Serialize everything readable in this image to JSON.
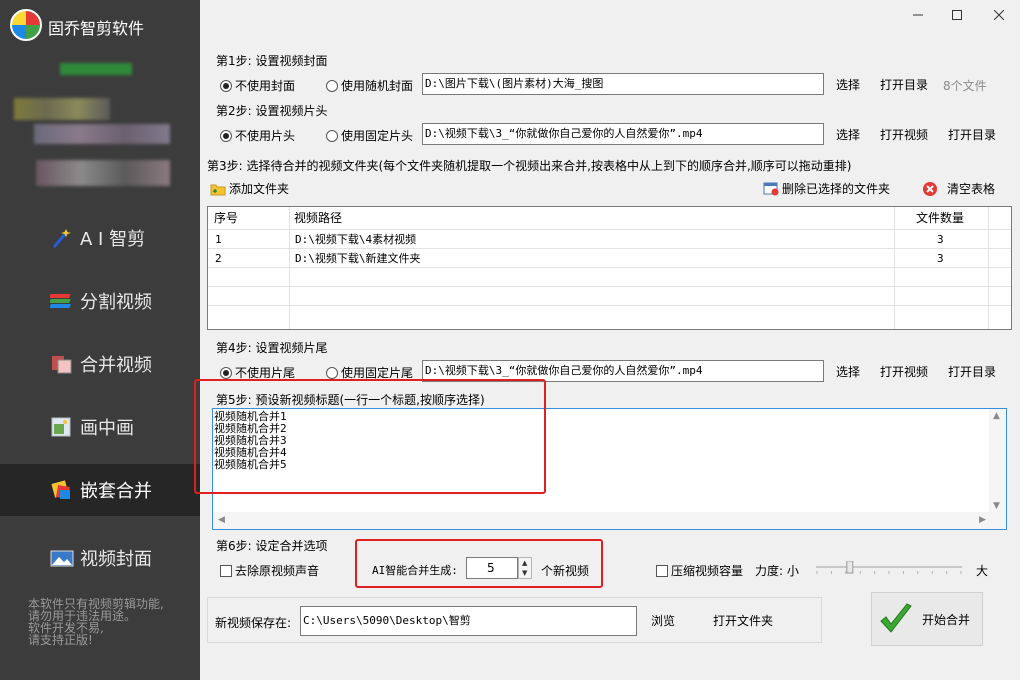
{
  "app": {
    "title": "固乔智剪软件"
  },
  "sidebar": {
    "items": [
      {
        "label": "A I 智剪",
        "icon": "magic-wand-icon"
      },
      {
        "label": "分割视频",
        "icon": "split-film-icon"
      },
      {
        "label": "合并视频",
        "icon": "merge-film-icon"
      },
      {
        "label": "画中画",
        "icon": "picture-in-picture-icon"
      },
      {
        "label": "嵌套合并",
        "icon": "nested-merge-icon"
      },
      {
        "label": "视频封面",
        "icon": "cover-image-icon"
      }
    ],
    "note": [
      "本软件只有视频剪辑功能,",
      "请勿用于违法用途。",
      "软件开发不易,",
      "请支持正版!"
    ]
  },
  "step1": {
    "label": "第1步: 设置视频封面",
    "opt_none": "不使用封面",
    "opt_random": "使用随机封面",
    "path": "D:\\图片下载\\(图片素材)大海_搜图",
    "btn_select": "选择",
    "btn_open_dir": "打开目录",
    "file_count": "8个文件"
  },
  "step2": {
    "label": "第2步: 设置视频片头",
    "opt_none": "不使用片头",
    "opt_fixed": "使用固定片头",
    "path": "D:\\视频下载\\3_“你就做你自己爱你的人自然爱你”.mp4",
    "btn_select": "选择",
    "btn_open_video": "打开视频",
    "btn_open_dir": "打开目录"
  },
  "step3": {
    "label": "第3步: 选择待合并的视频文件夹(每个文件夹随机提取一个视频出来合并,按表格中从上到下的顺序合并,顺序可以拖动重排)",
    "btn_add": "添加文件夹",
    "btn_delete": "删除已选择的文件夹",
    "btn_clear": "清空表格",
    "columns": {
      "index": "序号",
      "path": "视频路径",
      "count": "文件数量"
    },
    "rows": [
      {
        "index": "1",
        "path": "D:\\视频下载\\4素材视频",
        "count": "3"
      },
      {
        "index": "2",
        "path": "D:\\视频下载\\新建文件夹",
        "count": "3"
      }
    ]
  },
  "step4": {
    "label": "第4步: 设置视频片尾",
    "opt_none": "不使用片尾",
    "opt_fixed": "使用固定片尾",
    "path": "D:\\视频下载\\3_“你就做你自己爱你的人自然爱你”.mp4",
    "btn_select": "选择",
    "btn_open_video": "打开视频",
    "btn_open_dir": "打开目录"
  },
  "step5": {
    "label": "第5步: 预设新视频标题(一行一个标题,按顺序选择)",
    "titles": [
      "视频随机合并1",
      "视频随机合并2",
      "视频随机合并3",
      "视频随机合并4",
      "视频随机合并5"
    ]
  },
  "step6": {
    "label": "第6步: 设定合并选项",
    "remove_audio": "去除原视频声音",
    "ai_label": "AI智能合并生成:",
    "count": "5",
    "count_unit": "个新视频",
    "compress": "压缩视频容量",
    "strength_label": "力度: 小",
    "strength_max": "大",
    "strength_level": 0.22
  },
  "save": {
    "label": "新视频保存在:",
    "path": "C:\\Users\\5090\\Desktop\\智剪",
    "btn_browse": "浏览",
    "btn_open_folder": "打开文件夹"
  },
  "start_btn": "开始合并",
  "colors": {
    "sidebar_bg": "#3c3c3c",
    "sidebar_active": "#262626",
    "highlight_red": "#e02020",
    "accent_blue": "#3a8fd8",
    "check_green": "#3aa832"
  }
}
